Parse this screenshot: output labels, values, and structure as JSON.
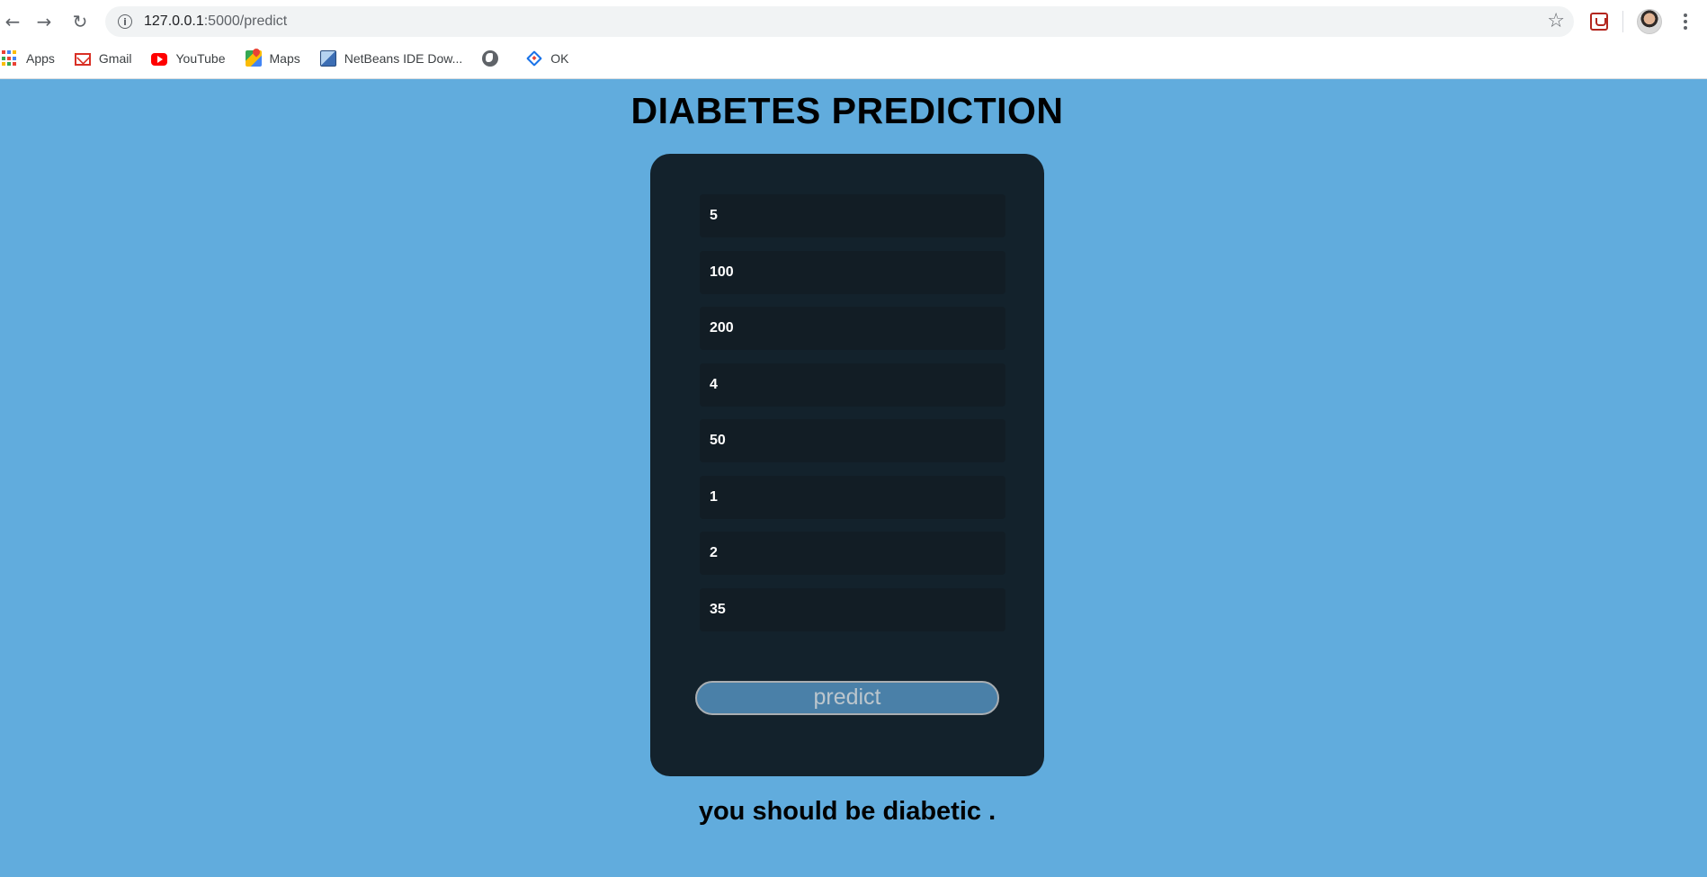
{
  "browser": {
    "url_host": "127.0.0.1",
    "url_path": ":5000/predict",
    "back_icon": "arrow-left-icon",
    "forward_icon": "arrow-right-icon",
    "reload_icon": "reload-icon",
    "bookmarks": [
      {
        "label": "Apps",
        "icon": "apps-grid-icon"
      },
      {
        "label": "Gmail",
        "icon": "gmail-icon"
      },
      {
        "label": "YouTube",
        "icon": "youtube-icon"
      },
      {
        "label": "Maps",
        "icon": "maps-icon"
      },
      {
        "label": "NetBeans IDE Dow...",
        "icon": "netbeans-icon"
      },
      {
        "label": "",
        "icon": "globe-icon"
      },
      {
        "label": "OK",
        "icon": "ok-icon"
      }
    ]
  },
  "page": {
    "title": "DIABETES PREDICTION",
    "background_color": "#61acdd",
    "card_color": "#13222c",
    "fields": [
      {
        "value": "5"
      },
      {
        "value": "100"
      },
      {
        "value": "200"
      },
      {
        "value": "4"
      },
      {
        "value": "50"
      },
      {
        "value": "1"
      },
      {
        "value": "2"
      },
      {
        "value": "35"
      }
    ],
    "predict_label": "predict",
    "result_text": "you should be diabetic ."
  }
}
